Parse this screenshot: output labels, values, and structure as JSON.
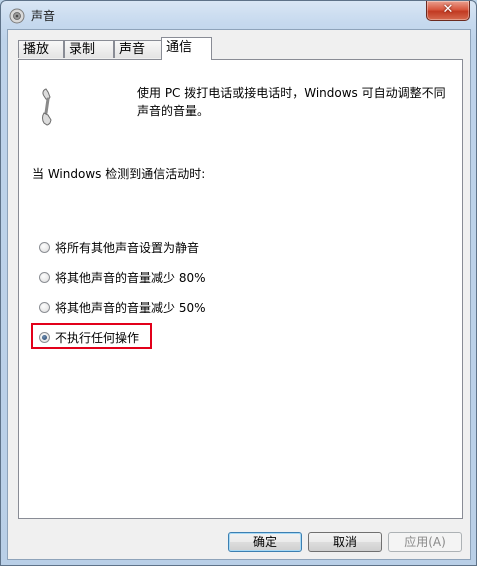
{
  "window": {
    "title": "声音",
    "close_label": "✕"
  },
  "tabs": [
    {
      "label": "播放"
    },
    {
      "label": "录制"
    },
    {
      "label": "声音"
    },
    {
      "label": "通信"
    }
  ],
  "active_tab": "通信",
  "communications": {
    "description": "使用 PC 拨打电话或接电话时，Windows 可自动调整不同声音的音量。",
    "when_label": "当 Windows 检测到通信活动时:",
    "options": [
      {
        "label": "将所有其他声音设置为静音",
        "selected": false
      },
      {
        "label": "将其他声音的音量减少 80%",
        "selected": false
      },
      {
        "label": "将其他声音的音量减少 50%",
        "selected": false
      },
      {
        "label": "不执行任何操作",
        "selected": true
      }
    ]
  },
  "buttons": {
    "ok": "确定",
    "cancel": "取消",
    "apply": "应用(A)"
  },
  "icons": {
    "app": "speaker-icon",
    "panel": "telephone-icon"
  },
  "colors": {
    "highlight": "#e2001a"
  }
}
